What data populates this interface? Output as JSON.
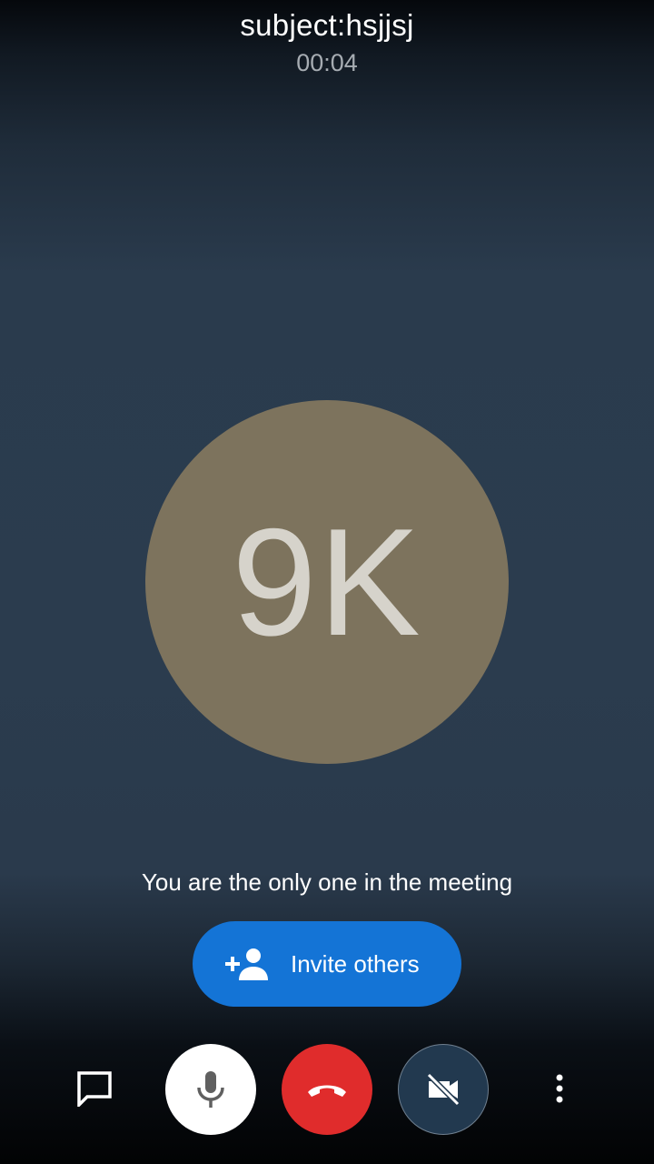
{
  "call": {
    "subject": "subject:hsjjsj",
    "elapsed_time": "00:04"
  },
  "participant": {
    "initials": "9K",
    "avatar_color": "#7d735d"
  },
  "status_message": "You are the only one in the meeting",
  "invite": {
    "label": "Invite others",
    "icon": "person-add-icon"
  },
  "toolbar": {
    "chat_icon": "chat-bubble-icon",
    "mic_icon": "microphone-icon",
    "hangup_icon": "phone-hangup-icon",
    "video_icon": "video-off-icon",
    "more_icon": "more-vertical-icon"
  },
  "colors": {
    "invite_button": "#1474d6",
    "hangup_button": "#e02c2c",
    "mic_button": "#ffffff",
    "video_button": "#22394f"
  }
}
